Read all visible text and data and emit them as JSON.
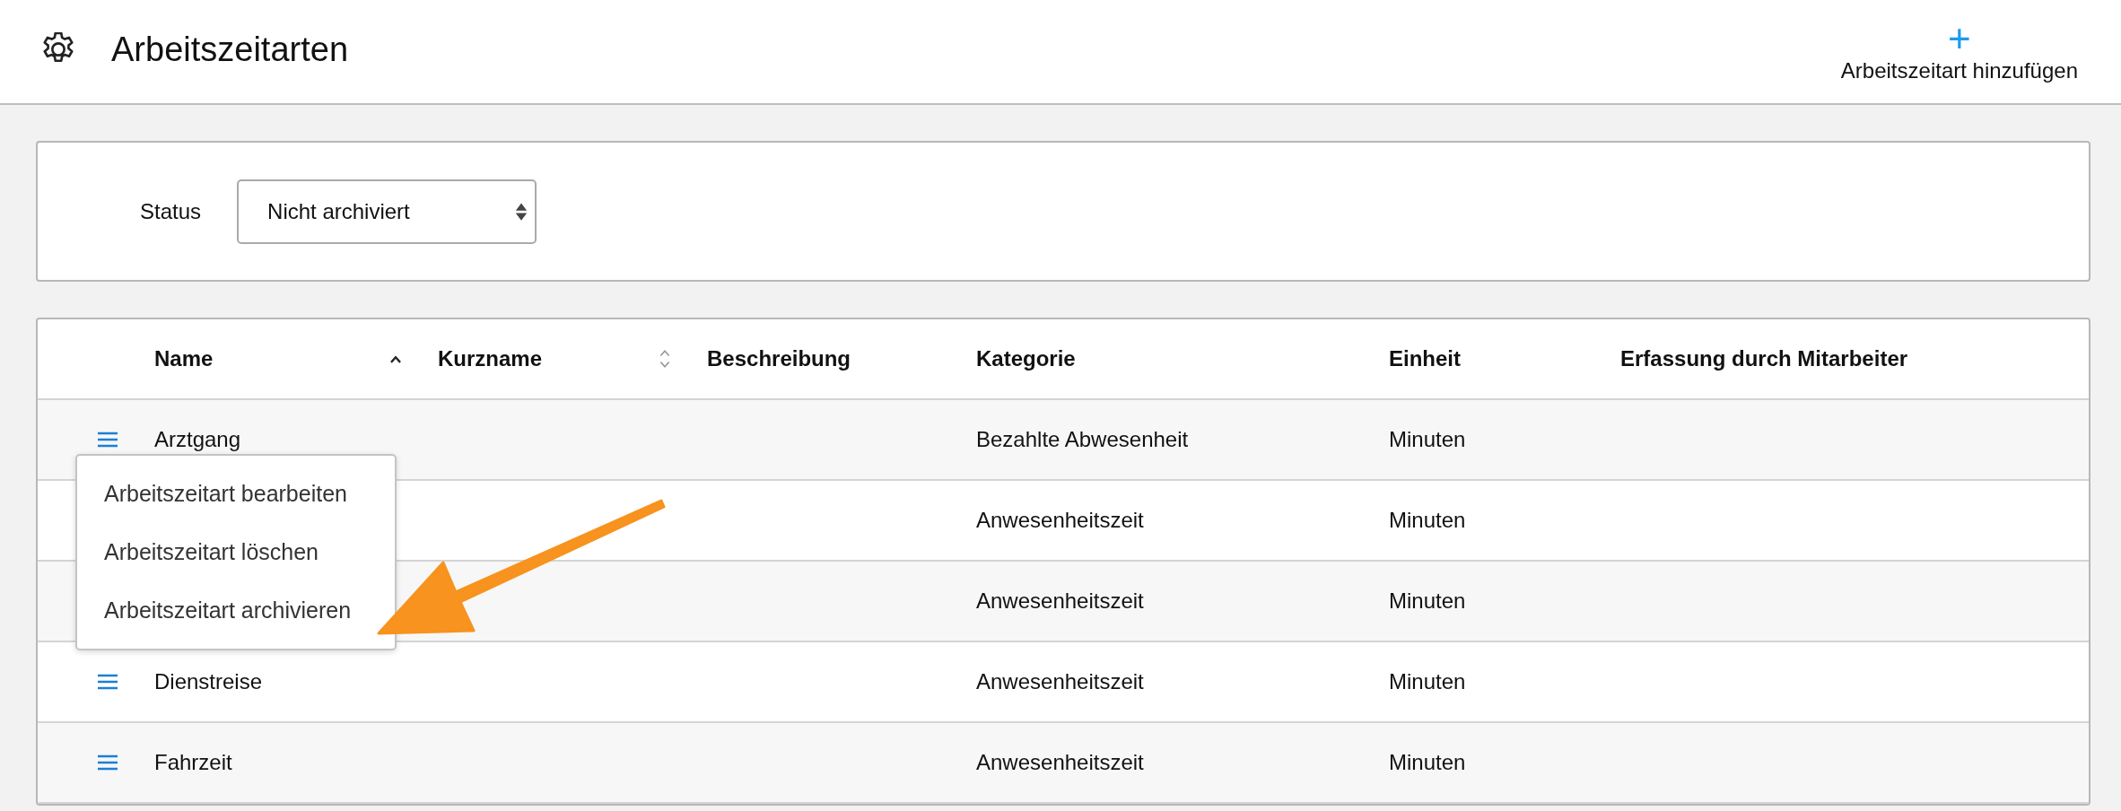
{
  "header": {
    "title": "Arbeitszeitarten",
    "add_button": {
      "icon": "+",
      "label": "Arbeitszeitart hinzufügen"
    }
  },
  "filter": {
    "label": "Status",
    "value": "Nicht archiviert"
  },
  "table": {
    "columns": [
      {
        "label": "Name",
        "sortable": true,
        "sorted": true
      },
      {
        "label": "Kurzname",
        "sortable": true,
        "sorted": false
      },
      {
        "label": "Beschreibung"
      },
      {
        "label": "Kategorie"
      },
      {
        "label": "Einheit"
      },
      {
        "label": "Erfassung durch Mitarbeiter"
      }
    ],
    "rows": [
      {
        "name": "Arztgang",
        "category": "Bezahlte Abwesenheit",
        "unit": "Minuten"
      },
      {
        "category": "Anwesenheitszeit",
        "unit": "Minuten"
      },
      {
        "category": "Anwesenheitszeit",
        "unit": "Minuten"
      },
      {
        "name": "Dienstreise",
        "category": "Anwesenheitszeit",
        "unit": "Minuten"
      },
      {
        "name": "Fahrzeit",
        "category": "Anwesenheitszeit",
        "unit": "Minuten"
      }
    ]
  },
  "row_menu": {
    "items": [
      "Arbeitszeitart bearbeiten",
      "Arbeitszeitart löschen",
      "Arbeitszeitart archivieren"
    ]
  }
}
